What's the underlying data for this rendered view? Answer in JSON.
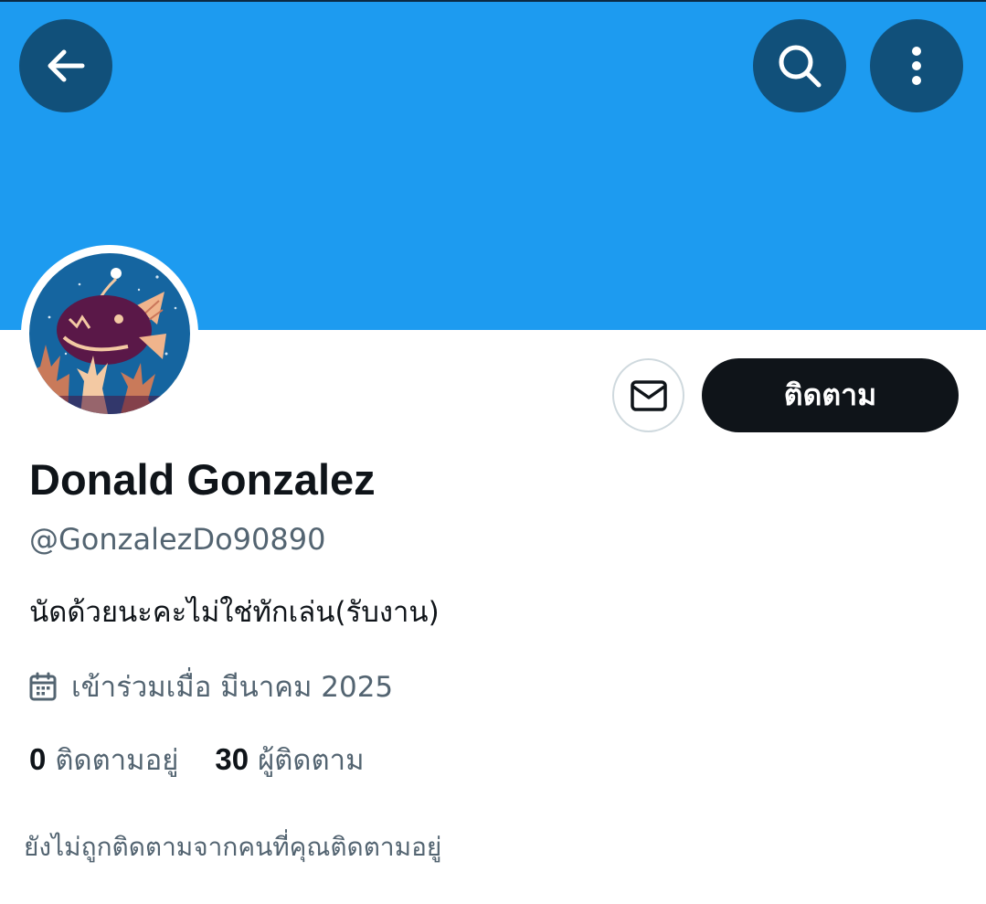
{
  "header": {
    "back_icon": "arrow-left-icon",
    "search_icon": "search-icon",
    "more_icon": "more-vertical-icon",
    "banner_color": "#1d9bf0",
    "button_color": "#11507a"
  },
  "profile": {
    "avatar_icon": "anglerfish-avatar",
    "display_name": "Donald Gonzalez",
    "handle": "@GonzalezDo90890",
    "bio": "นัดด้วยนะคะไม่ใช่ทักเล่น(รับงาน)",
    "joined_icon": "calendar-icon",
    "joined": "เข้าร่วมเมื่อ มีนาคม 2025",
    "following_count": "0",
    "following_label": "ติดตามอยู่",
    "followers_count": "30",
    "followers_label": "ผู้ติดตาม",
    "not_followed_note": "ยังไม่ถูกติดตามจากคนที่คุณติดตามอยู่"
  },
  "actions": {
    "message_icon": "mail-icon",
    "follow_label": "ติดตาม"
  },
  "colors": {
    "primary_text": "#0f1419",
    "secondary_text": "#536471",
    "follow_button_bg": "#0f1419"
  }
}
